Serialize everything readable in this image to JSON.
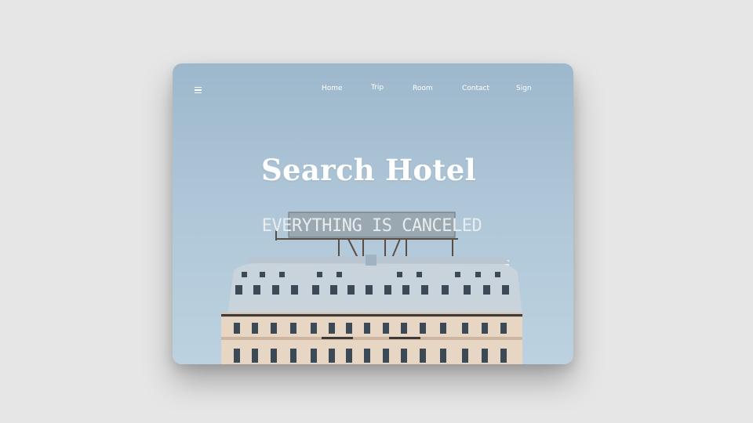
{
  "nav": {
    "menu_icon": "hamburger-menu-icon",
    "links": [
      {
        "label": "Home"
      },
      {
        "label": "Trip"
      },
      {
        "label": "Room"
      },
      {
        "label": "Contact"
      },
      {
        "label": "Sign"
      }
    ]
  },
  "hero": {
    "title": "Search Hotel",
    "billboard_text": "EVERYTHING IS CANCELED"
  },
  "colors": {
    "page_background": "#e6e6e6",
    "sky": "#aec6d7",
    "building": "#e8d6c4",
    "roof": "#c9d3dc",
    "text": "#ffffff"
  }
}
